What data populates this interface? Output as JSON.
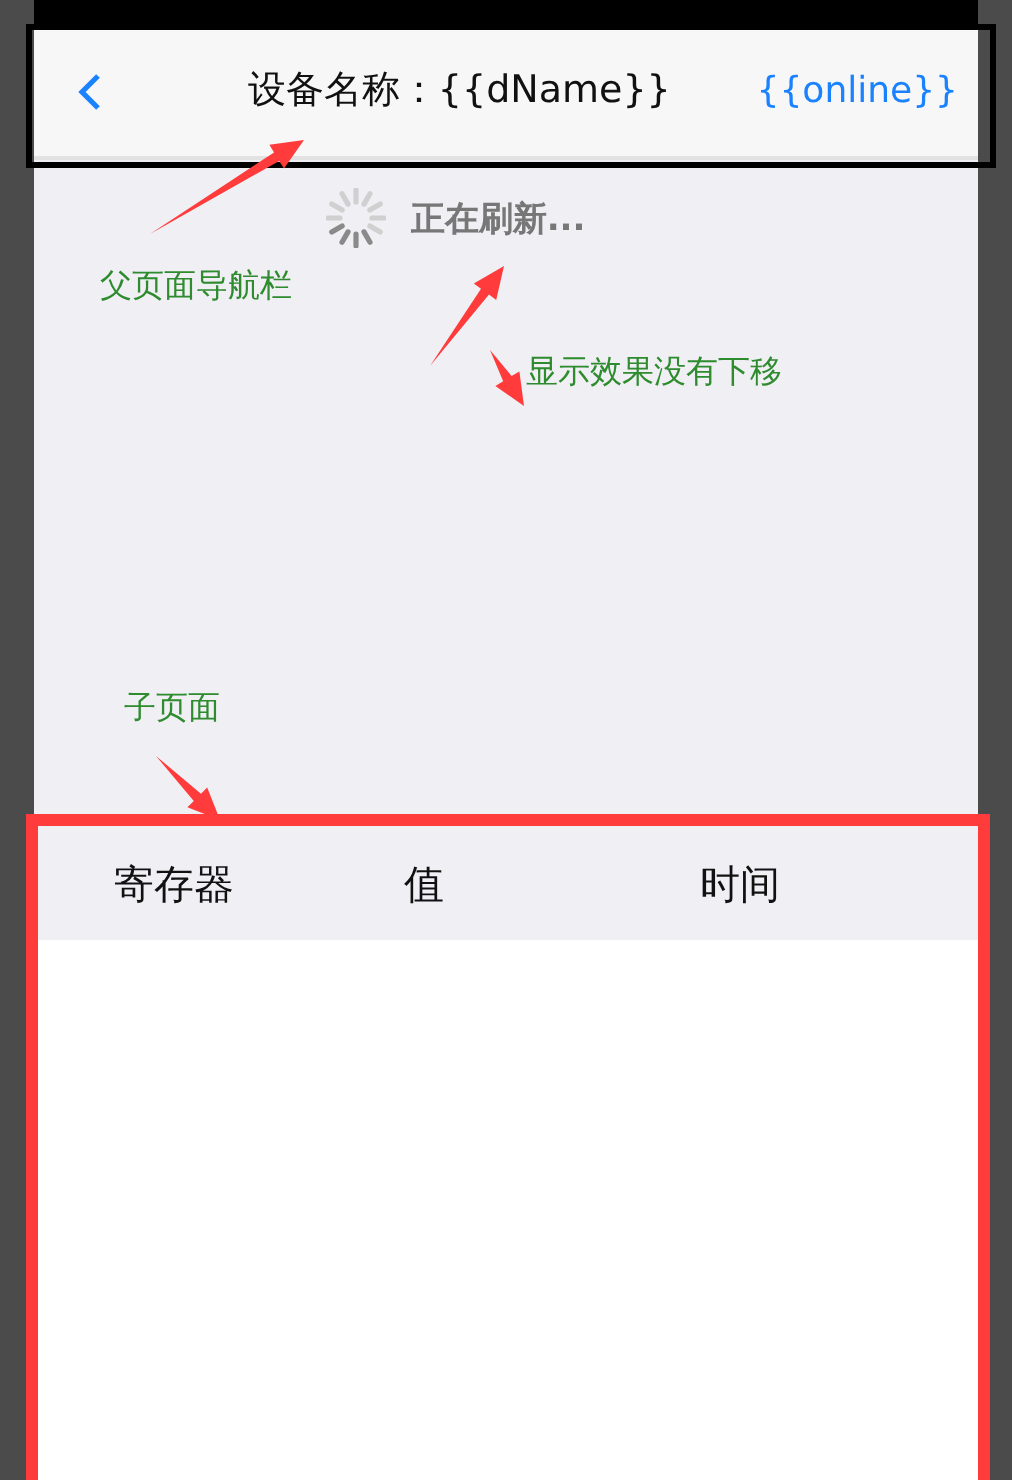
{
  "nav": {
    "title": "设备名称：{{dName}}",
    "action": "{{online}}"
  },
  "refresh": {
    "text": "正在刷新..."
  },
  "table": {
    "columns": [
      "寄存器",
      "值",
      "时间"
    ]
  },
  "annotations": [
    {
      "text": "父页面导航栏"
    },
    {
      "text": "显示效果没有下移"
    },
    {
      "text": "子页面"
    }
  ]
}
